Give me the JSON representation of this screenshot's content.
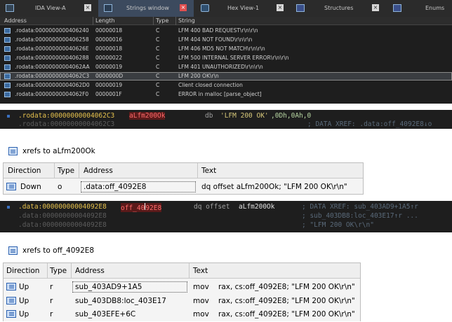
{
  "strings_window": {
    "tabs": [
      {
        "label": "IDA View-A",
        "icon": "ida-view-icon",
        "active": false
      },
      {
        "label": "Strings window",
        "icon": "strings-icon",
        "active": true
      },
      {
        "label": "Hex View-1",
        "icon": "hex-icon",
        "active": false
      },
      {
        "label": "Structures",
        "icon": "structures-icon",
        "active": false
      },
      {
        "label": "Enums",
        "icon": "enums-icon",
        "active": false
      }
    ],
    "close_glyph": "×",
    "columns": [
      "Address",
      "Length",
      "Type",
      "String"
    ],
    "rows": [
      {
        "address": ".rodata:0000000000406240",
        "length": "00000018",
        "type": "C",
        "string": "LFM 400 BAD REQUEST\\r\\n\\r\\n"
      },
      {
        "address": ".rodata:0000000000406258",
        "length": "00000016",
        "type": "C",
        "string": "LFM 404 NOT FOUND\\r\\n\\r\\n"
      },
      {
        "address": ".rodata:000000000040626E",
        "length": "00000018",
        "type": "C",
        "string": "LFM 406 MD5 NOT MATCH\\r\\n\\r\\n"
      },
      {
        "address": ".rodata:0000000000406288",
        "length": "00000022",
        "type": "C",
        "string": "LFM 500 INTERNAL SERVER ERROR\\r\\n\\r\\n"
      },
      {
        "address": ".rodata:00000000004062AA",
        "length": "00000019",
        "type": "C",
        "string": "LFM 401 UNAUTHORIZED\\r\\n\\r\\n"
      },
      {
        "address": ".rodata:00000000004062C3",
        "length": "0000000D",
        "type": "C",
        "string": "LFM 200 OK\\r\\n"
      },
      {
        "address": ".rodata:00000000004062D0",
        "length": "00000019",
        "type": "C",
        "string": "Client closed connection"
      },
      {
        "address": ".rodata:00000000004062F0",
        "length": "0000001F",
        "type": "C",
        "string": "ERROR in malloc [parse_object]"
      }
    ],
    "selected_index": 5
  },
  "asm1": {
    "line1": {
      "seg": ".rodata:00000000004062C3",
      "name": "aLfm200Ok",
      "op": "db",
      "str": "'LFM 200 OK'",
      "rest": ",0Dh,0Ah,0"
    },
    "line2": {
      "seg": ".rodata:00000000004062C3",
      "comment": "; DATA XREF: .data:off_4092E8↓o"
    }
  },
  "xref1": {
    "title": "xrefs to aLfm200Ok",
    "columns": [
      "Direction",
      "Type",
      "Address",
      "Text"
    ],
    "rows": [
      {
        "direction": "Down",
        "type": "o",
        "address": ".data:off_4092E8",
        "text": "dq offset aLfm200Ok; \"LFM 200 OK\\r\\n\""
      }
    ]
  },
  "asm2": {
    "line1": {
      "seg": ".data:00000000004092E8",
      "name_a": "off_40",
      "name_b": "92E8",
      "op": "dq offset",
      "target": "aLfm200Ok",
      "comment": "; DATA XREF: sub_403AD9+1A5↑r"
    },
    "line2": {
      "seg": ".data:00000000004092E8",
      "comment": "; sub_403DB8:loc_403E17↑r ..."
    },
    "line3": {
      "seg": ".data:00000000004092E8",
      "comment": "; \"LFM 200 OK\\r\\n\""
    }
  },
  "xref2": {
    "title": "xrefs to off_4092E8",
    "columns": [
      "Direction",
      "Type",
      "Address",
      "Text"
    ],
    "rows": [
      {
        "direction": "Up",
        "type": "r",
        "address": "sub_403AD9+1A5",
        "mnemonic": "mov",
        "operands": "rax, cs:off_4092E8; \"LFM 200 OK\\r\\n\""
      },
      {
        "direction": "Up",
        "type": "r",
        "address": "sub_403DB8:loc_403E17",
        "mnemonic": "mov",
        "operands": "rax, cs:off_4092E8; \"LFM 200 OK\\r\\n\""
      },
      {
        "direction": "Up",
        "type": "r",
        "address": "sub_403EFE+6C",
        "mnemonic": "mov",
        "operands": "rax, cs:off_4092E8; \"LFM 200 OK\\r\\n\""
      }
    ]
  }
}
